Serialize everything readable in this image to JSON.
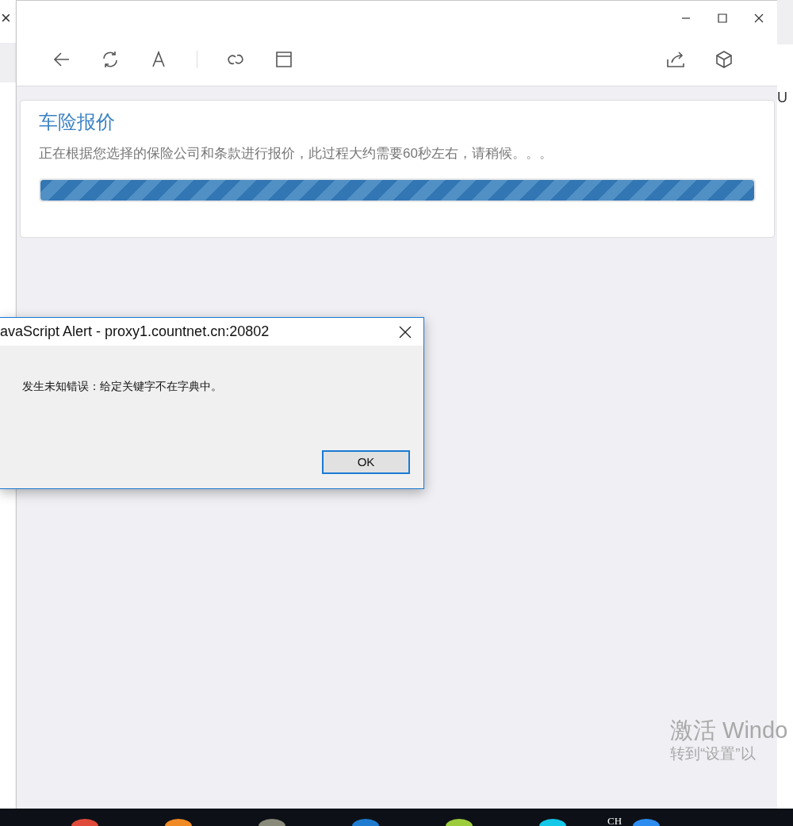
{
  "background_page": {
    "close_glyph": "×",
    "header_fragment": "U"
  },
  "window": {
    "caption_buttons": [
      {
        "kind": "minimize"
      },
      {
        "kind": "maximize"
      },
      {
        "kind": "close"
      }
    ]
  },
  "toolbar": {
    "left": [
      {
        "kind": "back"
      },
      {
        "kind": "refresh"
      },
      {
        "kind": "font"
      },
      {
        "kind": "divider"
      },
      {
        "kind": "link"
      },
      {
        "kind": "window"
      }
    ],
    "right": [
      {
        "kind": "share"
      },
      {
        "kind": "cube"
      }
    ]
  },
  "card": {
    "title": "车险报价",
    "message": "正在根据您选择的保险公司和条款进行报价，此过程大约需要60秒左右，请稍候。。。",
    "progress": {
      "level": 1
    }
  },
  "alert": {
    "title": "avaScript Alert - proxy1.countnet.cn:20802",
    "message": "发生未知错误：给定关键字不在字典中。",
    "button": "OK"
  },
  "activation_notice": {
    "line_1": "激活 Windo",
    "line_2": "转到“设置”以"
  },
  "taskbar": {
    "apps": [
      {
        "color": "#e04a3a"
      },
      {
        "color": "#f08a24"
      },
      {
        "color": "#8a8a7a"
      },
      {
        "color": "#1e7bd0"
      },
      {
        "color": "#9ccc3c"
      },
      {
        "color": "#14c8e8"
      },
      {
        "color": "#2d8cf0"
      }
    ],
    "language": "CH"
  }
}
